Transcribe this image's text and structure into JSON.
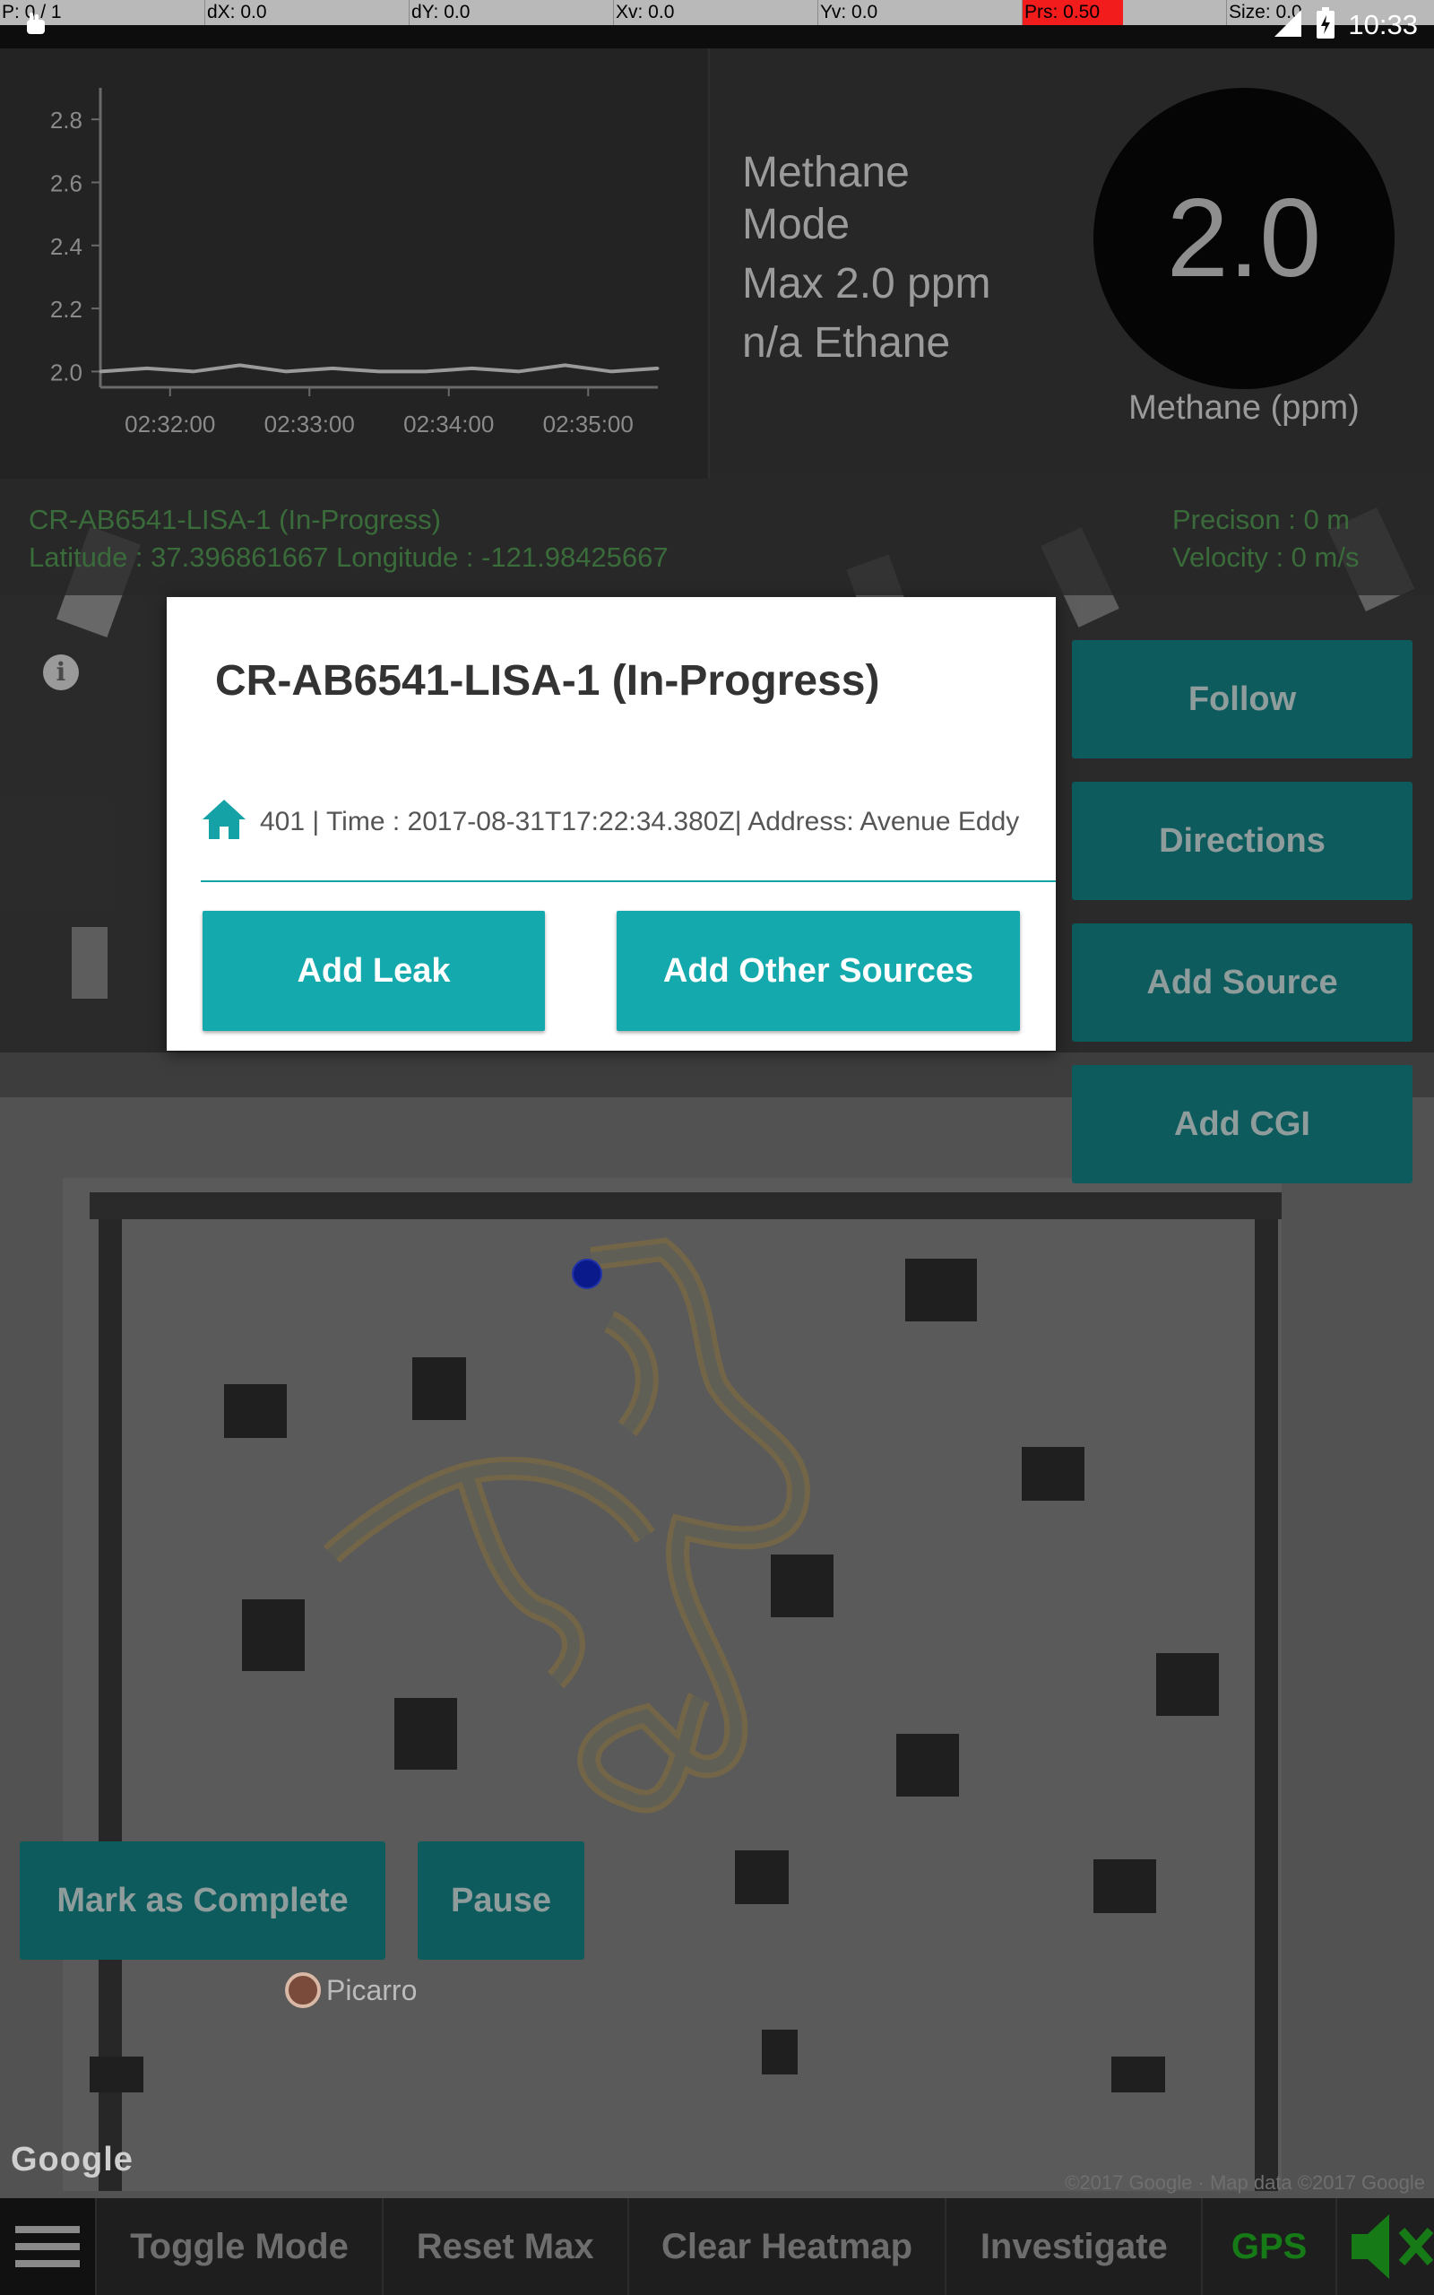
{
  "status_bar": {
    "debug": {
      "p": "P: 0 / 1",
      "dx": "dX: 0.0",
      "dy": "dY: 0.0",
      "xv": "Xv: 0.0",
      "yv": "Yv: 0.0",
      "prs": "Prs: 0.50",
      "size": "Size: 0.0"
    },
    "time": "10:33"
  },
  "chart_data": {
    "type": "line",
    "title": "",
    "xlabel": "",
    "ylabel": "",
    "ylim": [
      1.95,
      2.9
    ],
    "y_ticks": [
      "2.8",
      "2.6",
      "2.4",
      "2.2",
      "2.0"
    ],
    "x_ticks": [
      "02:32:00",
      "02:33:00",
      "02:34:00",
      "02:35:00"
    ],
    "x": [
      "02:31:30",
      "02:31:50",
      "02:32:10",
      "02:32:30",
      "02:32:50",
      "02:33:10",
      "02:33:30",
      "02:33:50",
      "02:34:10",
      "02:34:30",
      "02:34:50",
      "02:35:10",
      "02:35:30"
    ],
    "series": [
      {
        "values": [
          2.0,
          2.01,
          2.0,
          2.02,
          2.0,
          2.01,
          2.0,
          2.0,
          2.01,
          2.0,
          2.02,
          2.0,
          2.01
        ]
      }
    ],
    "grid": false,
    "colors": {
      "line": "#9a9a9a",
      "axis": "#6a6a6a"
    }
  },
  "header": {
    "mode": "Methane Mode",
    "max": "Max 2.0 ppm",
    "ethane": "n/a Ethane",
    "gauge_value": "2.0",
    "gauge_label": "Methane (ppm)"
  },
  "map": {
    "survey": "CR-AB6541-LISA-1  (In-Progress)",
    "coords": "Latitude : 37.396861667  Longitude  :  -121.98425667",
    "precision": "Precison : 0  m",
    "velocity": "Velocity : 0  m/s",
    "side_buttons": [
      "Follow",
      "Directions",
      "Add Source",
      "Add CGI"
    ],
    "mark_complete": "Mark as Complete",
    "pause": "Pause",
    "poi_label": "Picarro",
    "google_logo": "Google",
    "copyright": "©2017 Google · Map data ©2017 Google"
  },
  "dialog": {
    "title": "CR-AB6541-LISA-1  (In-Progress)",
    "row": "401 | Time : 2017-08-31T17:22:34.380Z| Address: Avenue Eddy",
    "add_leak": "Add Leak",
    "add_other": "Add Other Sources"
  },
  "bottom_nav": {
    "items": [
      "Toggle Mode",
      "Reset Max",
      "Clear Heatmap",
      "Investigate",
      "GPS"
    ]
  },
  "colors": {
    "accent": "#14a9ad",
    "map_button": "#0e5b5d",
    "gps_active": "#167a16",
    "position_marker": "#0a1a8a"
  }
}
